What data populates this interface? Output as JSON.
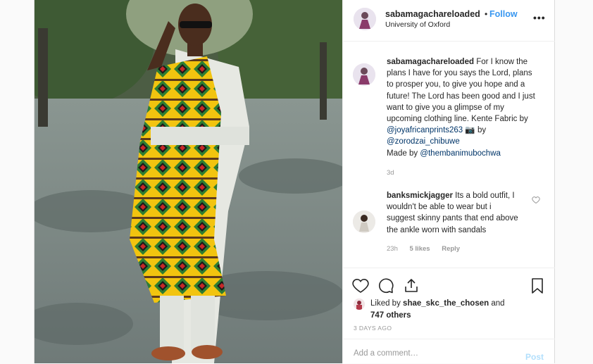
{
  "post": {
    "username": "sabamagachareloaded",
    "separator": "•",
    "follow_label": "Follow",
    "location": "University of Oxford",
    "more_icon": "more-dots-icon",
    "more_label": "•••"
  },
  "caption": {
    "username": "sabamagachareloaded",
    "text_part1": "For I know the plans I have for you says the Lord, plans to prosper you, to give you hope and a future! The Lord has been good and I just want to give you a glimpse of my upcoming clothing line. Kente Fabric by",
    "mention1": "@joyafricanprints263",
    "camera_emoji": "📷",
    "text_part2": "by",
    "mention2": "@zorodzai_chibuwe",
    "text_part3": "Made by",
    "mention3": "@thembanimubochwa",
    "time": "3d"
  },
  "comment": {
    "username": "banksmickjagger",
    "text": "Its a bold outfit, I wouldn't be able to wear but i suggest skinny pants that end above the ankle worn with sandals",
    "time": "23h",
    "likes": "5 likes",
    "reply_label": "Reply"
  },
  "actions": {
    "like_icon": "heart-icon",
    "comment_icon": "comment-icon",
    "share_icon": "share-icon",
    "save_icon": "bookmark-icon"
  },
  "likes": {
    "prefix": "Liked by",
    "user": "shae_skc_the_chosen",
    "and": "and",
    "others": "747 others"
  },
  "date": "3 DAYS AGO",
  "add_comment": {
    "placeholder": "Add a comment…",
    "post_label": "Post"
  },
  "colors": {
    "link_blue": "#3897f0",
    "mention_blue": "#003569",
    "post_disabled": "#b2dffc",
    "muted": "#999999"
  }
}
